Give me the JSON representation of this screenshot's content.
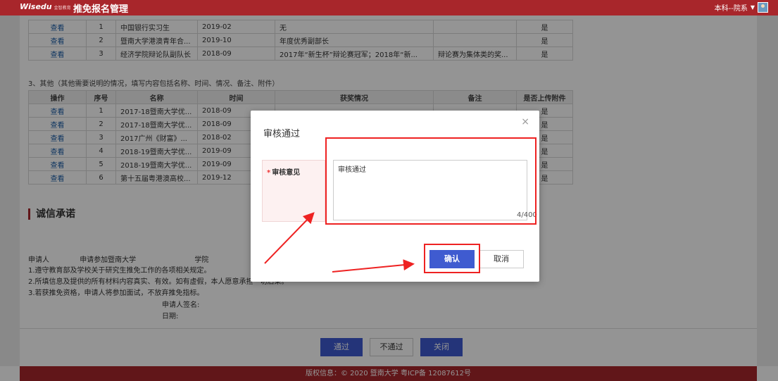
{
  "header": {
    "brand": "Wisedu",
    "brand_sub": "金智教育",
    "app_title": "推免报名管理",
    "user_role": "本科--院系"
  },
  "table_top": {
    "rows": [
      {
        "op": "查看",
        "no": "1",
        "name": "中国银行实习生",
        "time": "2019-02",
        "desc": "无",
        "note": "",
        "att": "是"
      },
      {
        "op": "查看",
        "no": "2",
        "name": "暨南大学港澳青年合...",
        "time": "2019-10",
        "desc": "年度优秀副部长",
        "note": "",
        "att": "是"
      },
      {
        "op": "查看",
        "no": "3",
        "name": "经济学院辩论队副队长",
        "time": "2018-09",
        "desc": "2017年“新生杯”辩论赛冠军；2018年“新...",
        "note": "辩论赛为集体类的奖...",
        "att": "是"
      }
    ]
  },
  "section3": {
    "label": "3、其他（其他需要说明的情况，填写内容包括名称、时间、情况、备注、附件）",
    "headers": [
      "操作",
      "序号",
      "名称",
      "时间",
      "获奖情况",
      "备注",
      "是否上传附件"
    ],
    "rows": [
      {
        "op": "查看",
        "no": "1",
        "name": "2017-18暨南大学优...",
        "time": "2018-09",
        "att": "是"
      },
      {
        "op": "查看",
        "no": "2",
        "name": "2017-18暨南大学优...",
        "time": "2018-09",
        "att": "是"
      },
      {
        "op": "查看",
        "no": "3",
        "name": "2017广州《财富》...",
        "time": "2018-02",
        "att": "是"
      },
      {
        "op": "查看",
        "no": "4",
        "name": "2018-19暨南大学优...",
        "time": "2019-09",
        "att": "是"
      },
      {
        "op": "查看",
        "no": "5",
        "name": "2018-19暨南大学优...",
        "time": "2019-09",
        "att": "是"
      },
      {
        "op": "查看",
        "no": "6",
        "name": "第十五届粤港澳高校...",
        "time": "2019-12",
        "att": "是"
      }
    ]
  },
  "pledge": {
    "heading": "诚信承诺",
    "applicant_label": "申请人",
    "apply_university": "申请参加暨南大学",
    "college_label": "学院",
    "item1": "1.遵守教育部及学校关于研究生推免工作的各项相关规定。",
    "item2": "2.所填信息及提供的所有材料内容真实、有效。如有虚假，本人愿意承担一切后果。",
    "item3": "3.若获推免资格，申请人将参加面试，不放弃推免指标。",
    "signature_label": "申请人签名:",
    "date_label": "日期:"
  },
  "actions": {
    "pass": "通过",
    "reject": "不通过",
    "close": "关闭"
  },
  "footer": {
    "copyright": "版权信息：© 2020 暨南大学 粤ICP备 12087612号"
  },
  "modal": {
    "title": "审核通过",
    "close_icon": "×",
    "field_label": "审核意见",
    "required_mark": "*",
    "textarea_value": "审核通过",
    "counter": "4/400",
    "confirm": "确认",
    "cancel": "取消"
  },
  "colors": {
    "brand_red": "#a8262b",
    "primary_blue": "#3f5bd0",
    "highlight_red": "#e22222"
  }
}
